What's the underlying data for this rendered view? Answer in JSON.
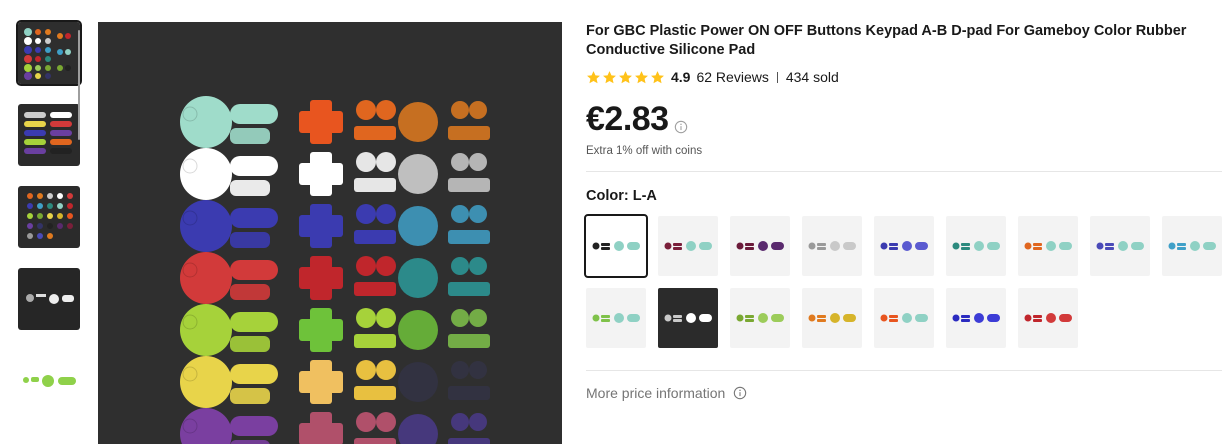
{
  "product": {
    "title": "For GBC Plastic Power ON OFF Buttons Keypad A-B D-pad For Gameboy Color Rubber Conductive Silicone Pad",
    "rating": "4.9",
    "reviews": "62 Reviews",
    "sold": "434 sold",
    "price": "€2.83",
    "coins_note": "Extra 1% off with coins",
    "color_label": "Color: L-A",
    "more_price_label": "More price information"
  },
  "icons": {
    "star": "star-icon",
    "info": "info-circle-icon"
  },
  "colors": {
    "star": "#ffc21a",
    "selected_border": "#191919",
    "muted_text": "#757575"
  },
  "thumbnails": [
    {
      "name": "all-colors-grid",
      "active": true
    },
    {
      "name": "all-colors-grid-2"
    },
    {
      "name": "all-colors-grid-3"
    },
    {
      "name": "gray-white-set"
    },
    {
      "name": "green-set"
    }
  ],
  "swatches": [
    {
      "id": "L-A",
      "primary": "#222222",
      "secondary": "#8fd1c4",
      "selected": true
    },
    {
      "id": "s2",
      "primary": "#7a1f3a",
      "secondary": "#8fd1c4"
    },
    {
      "id": "s3",
      "primary": "#6b1a3a",
      "secondary": "#5a2a6e"
    },
    {
      "id": "s4",
      "primary": "#9a9a9a",
      "secondary": "#c9c9c9"
    },
    {
      "id": "s5",
      "primary": "#3b3bb0",
      "secondary": "#5a5ad0"
    },
    {
      "id": "s6",
      "primary": "#2c8a7e",
      "secondary": "#8fd1c4"
    },
    {
      "id": "s7",
      "primary": "#e0661f",
      "secondary": "#8fd1c4"
    },
    {
      "id": "s8",
      "primary": "#4a4ab8",
      "secondary": "#8fd1c4"
    },
    {
      "id": "s9",
      "primary": "#3fa0c8",
      "secondary": "#8fd1c4"
    },
    {
      "id": "s10",
      "primary": "#7fc24a",
      "secondary": "#8fd1c4"
    },
    {
      "id": "s11",
      "primary": "#c9c9c9",
      "secondary": "#ffffff",
      "dark": true
    },
    {
      "id": "s12",
      "primary": "#7aa832",
      "secondary": "#9ccc5a"
    },
    {
      "id": "s13",
      "primary": "#e07a1f",
      "secondary": "#d6b42a"
    },
    {
      "id": "s14",
      "primary": "#e8551f",
      "secondary": "#8fd1c4"
    },
    {
      "id": "s15",
      "primary": "#2b2bc0",
      "secondary": "#3c3cd6"
    },
    {
      "id": "s16",
      "primary": "#c0262c",
      "secondary": "#d23a3a"
    }
  ]
}
